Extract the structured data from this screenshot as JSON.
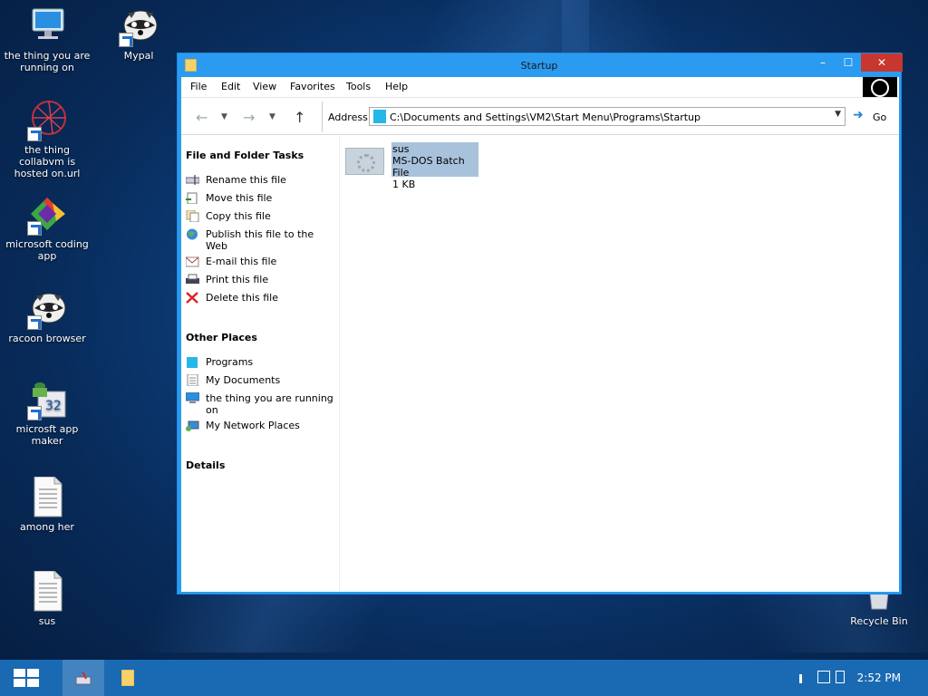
{
  "desktop": {
    "icons": [
      {
        "label": "the thing you are running on",
        "icon": "computer-icon"
      },
      {
        "label": "Mypal",
        "icon": "raccoon-icon"
      },
      {
        "label": "the thing collabvm is hosted on.url",
        "icon": "url-star-icon"
      },
      {
        "label": "microsoft coding app",
        "icon": "coding-app-icon"
      },
      {
        "label": "racoon browser",
        "icon": "raccoon-icon"
      },
      {
        "label": "microsft app maker",
        "icon": "app-maker-icon"
      },
      {
        "label": "among her",
        "icon": "text-file-icon"
      },
      {
        "label": "sus",
        "icon": "text-file-icon"
      },
      {
        "label": "Recycle Bin",
        "icon": "recycle-bin-icon"
      }
    ]
  },
  "window": {
    "title": "Startup",
    "controls": {
      "minimize": "–",
      "maximize": "☐",
      "close": "✕"
    },
    "menu": [
      "File",
      "Edit",
      "View",
      "Favorites",
      "Tools",
      "Help"
    ],
    "address_label": "Address",
    "address_value": "C:\\Documents and Settings\\VM2\\Start Menu\\Programs\\Startup",
    "go_label": "Go",
    "file_tasks": {
      "heading": "File and Folder Tasks",
      "items": [
        {
          "label": "Rename this file",
          "icon": "rename-icon"
        },
        {
          "label": "Move this file",
          "icon": "move-icon"
        },
        {
          "label": "Copy this file",
          "icon": "copy-icon"
        },
        {
          "label": "Publish this file to the Web",
          "icon": "globe-icon"
        },
        {
          "label": "E-mail this file",
          "icon": "email-icon"
        },
        {
          "label": "Print this file",
          "icon": "printer-icon"
        },
        {
          "label": "Delete this file",
          "icon": "delete-icon"
        }
      ]
    },
    "other_places": {
      "heading": "Other Places",
      "items": [
        {
          "label": "Programs",
          "icon": "folder-icon"
        },
        {
          "label": "My Documents",
          "icon": "documents-icon"
        },
        {
          "label": "the thing you are running on",
          "icon": "computer-icon"
        },
        {
          "label": "My Network Places",
          "icon": "network-icon"
        }
      ]
    },
    "details_heading": "Details",
    "files": [
      {
        "name": "sus",
        "type": "MS-DOS Batch File",
        "size": "1 KB"
      }
    ]
  },
  "taskbar": {
    "clock": "2:52 PM"
  },
  "colors": {
    "window_frame": "#2a9bf0",
    "taskbar": "#1a6ab3",
    "selection": "#a9c2dc",
    "close_button": "#c7372f"
  }
}
